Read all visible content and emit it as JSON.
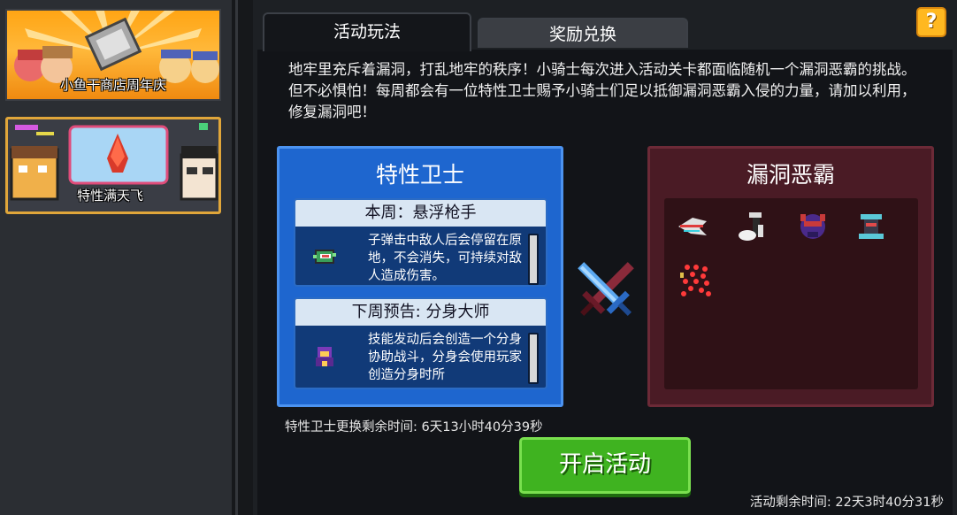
{
  "sidebar": {
    "banners": [
      {
        "label": "小鱼干商店周年庆"
      },
      {
        "label": "特性满天飞"
      }
    ]
  },
  "tabs": [
    {
      "label": "活动玩法",
      "active": true
    },
    {
      "label": "奖励兑换",
      "active": false
    }
  ],
  "help_button": {
    "label": "?"
  },
  "description": "地牢里充斥着漏洞，打乱地牢的秩序！小骑士每次进入活动关卡都面临随机一个漏洞恶霸的挑战。但不必惧怕！每周都会有一位特性卫士赐予小骑士们足以抵御漏洞恶霸入侵的力量，请加以利用，修复漏洞吧！",
  "guard_panel": {
    "title": "特性卫士",
    "current": {
      "heading": "本周：悬浮枪手",
      "text": "子弹击中敌人后会停留在原地，不会消失，可持续对敌人造成伤害。"
    },
    "next": {
      "heading": "下周预告: 分身大师",
      "text": "技能发动后会创造一个分身协助战斗，分身会使用玩家创造分身时所"
    }
  },
  "boss_panel": {
    "title": "漏洞恶霸",
    "bosses": [
      "glitch-fish-icon",
      "ghost-hand-icon",
      "purple-demon-icon",
      "robot-spinner-icon",
      "bullet-swarm-icon"
    ]
  },
  "swap_time_text": "特性卫士更换剩余时间:  6天13小时40分39秒",
  "start_button": {
    "label": "开启活动"
  },
  "event_time_text": "活动剩余时间: 22天3时40分31秒",
  "colors": {
    "guard_blue": "#1e66cf",
    "boss_red": "#4a1b25",
    "start_green": "#3fb320",
    "help_yellow": "#ffb820",
    "banner_border": "#e0a63a"
  }
}
